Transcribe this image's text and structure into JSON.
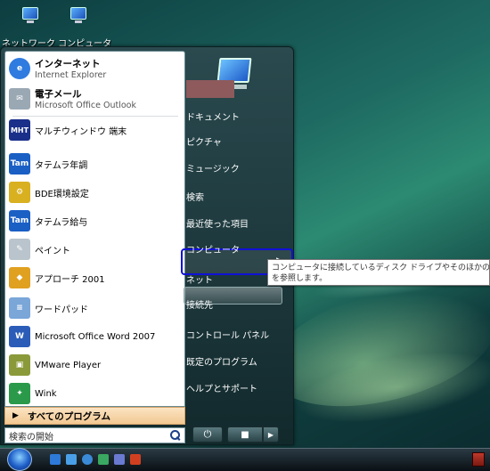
{
  "desktop": {
    "icons_label": "ネットワーク コンピュータ"
  },
  "start_menu": {
    "pinned": [
      {
        "title": "インターネット",
        "subtitle": "Internet Explorer",
        "icon": "internet-explorer-icon",
        "color": "#2f7be0"
      },
      {
        "title": "電子メール",
        "subtitle": "Microsoft Office Outlook",
        "icon": "mail-icon",
        "color": "#9aa8b4"
      }
    ],
    "programs": [
      {
        "label": "マルチウィンドウ 端末",
        "icon": "terminal-icon",
        "color": "#1a2f8a",
        "glyph": "MHT"
      },
      {
        "label": "タテムラ年調",
        "icon": "tatemura-icon",
        "color": "#1a5fc4",
        "glyph": "Tam"
      },
      {
        "label": "BDE環境設定",
        "icon": "bde-config-icon",
        "color": "#d8b020",
        "glyph": "⚙"
      },
      {
        "label": "タテムラ給与",
        "icon": "tatemura-icon",
        "color": "#1a5fc4",
        "glyph": "Tam"
      },
      {
        "label": "ペイント",
        "icon": "paint-icon",
        "color": "#b9c4cc",
        "glyph": "✎"
      },
      {
        "label": "アプローチ 2001",
        "icon": "approach-icon",
        "color": "#e0a020",
        "glyph": "◆"
      },
      {
        "label": "ワードパッド",
        "icon": "wordpad-icon",
        "color": "#7aa6d8",
        "glyph": "≡"
      },
      {
        "label": "Microsoft Office Word 2007",
        "icon": "word-icon",
        "color": "#2b5db8",
        "glyph": "W"
      },
      {
        "label": "VMware Player",
        "icon": "vmware-icon",
        "color": "#8a9a3a",
        "glyph": "▣"
      },
      {
        "label": "Wink",
        "icon": "wink-icon",
        "color": "#2a9a4a",
        "glyph": "✦"
      }
    ],
    "all_programs": "すべてのプログラム",
    "search_placeholder": "検索の開始",
    "right": {
      "documents": "ドキュメント",
      "pictures": "ピクチャ",
      "music": "ミュージック",
      "search": "検索",
      "recent": "最近使った項目",
      "computer": "コンピュータ",
      "network": "ネット",
      "connect": "接続先",
      "control_panel": "コントロール パネル",
      "default_programs": "既定のプログラム",
      "help": "ヘルプとサポート"
    },
    "tooltip_line1": "コンピュータに接続しているディスク ドライブやそのほかのハードウェア",
    "tooltip_line2": "を参照します。"
  }
}
